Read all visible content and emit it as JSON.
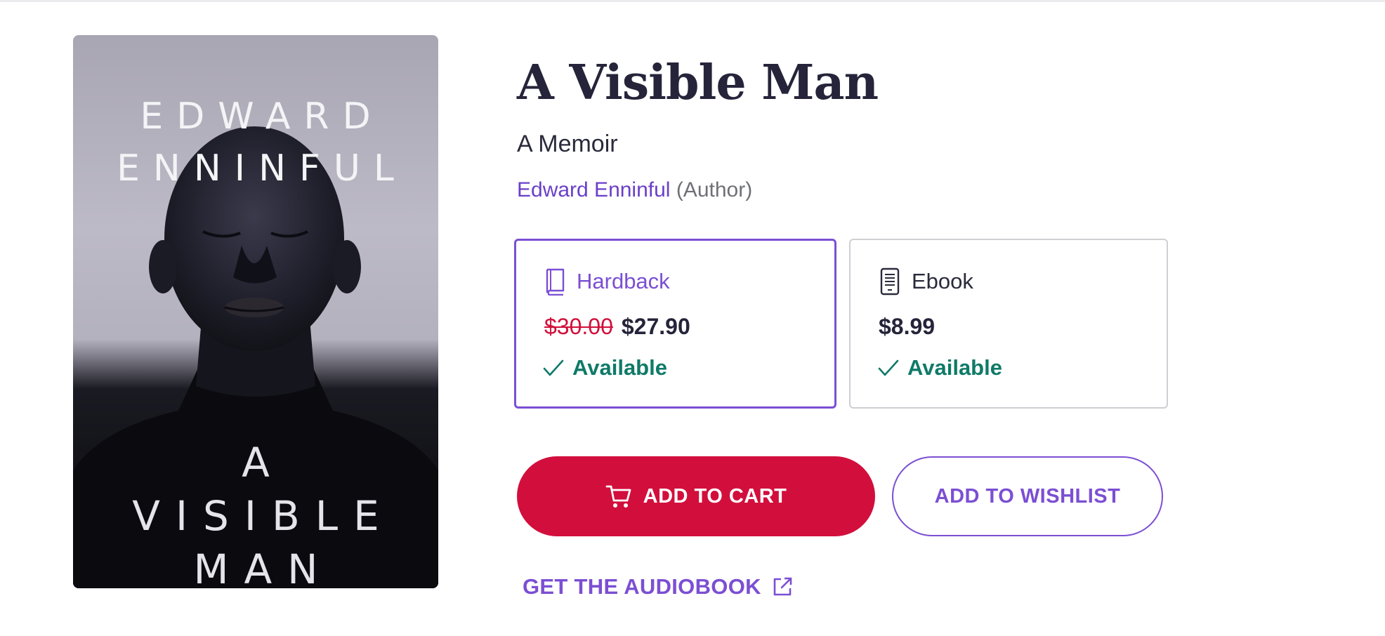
{
  "book": {
    "title": "A Visible Man",
    "subtitle": "A Memoir",
    "author": "Edward Enninful",
    "author_role": "(Author)"
  },
  "cover": {
    "author_line1": "EDWARD",
    "author_line2": "ENNINFUL",
    "title_line1": "A",
    "title_line2": "VISIBLE",
    "title_line3": "MAN"
  },
  "formats": [
    {
      "label": "Hardback",
      "icon": "book-icon",
      "original_price": "$30.00",
      "price": "$27.90",
      "status": "Available",
      "selected": true
    },
    {
      "label": "Ebook",
      "icon": "ebook-reader-icon",
      "price": "$8.99",
      "status": "Available",
      "selected": false
    }
  ],
  "actions": {
    "add_to_cart": "ADD TO CART",
    "add_to_wishlist": "ADD TO WISHLIST",
    "audiobook": "GET THE AUDIOBOOK"
  },
  "colors": {
    "accent_purple": "#7b4fd3",
    "cart_red": "#d20f3c",
    "available_green": "#0f7a68",
    "strike_red": "#d0103a"
  }
}
